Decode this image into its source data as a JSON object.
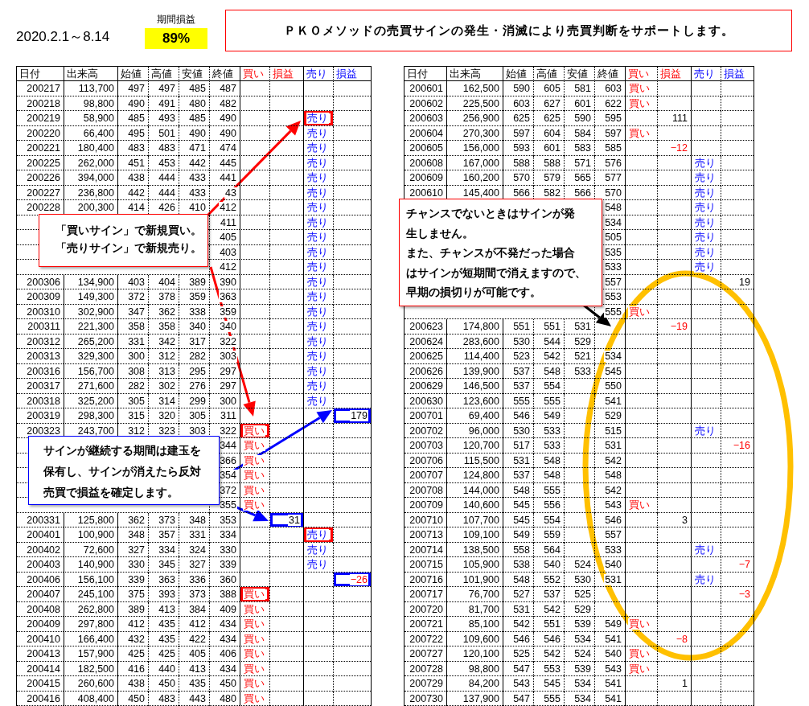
{
  "period": "2020.2.1～8.14",
  "profit": {
    "label": "期間損益",
    "value": "89%"
  },
  "banner": "ＰＫＯメソッドの売買サインの発生・消滅により売買判断をサポートします。",
  "tables": [
    {
      "columns": [
        {
          "label": "日付",
          "kind": "text"
        },
        {
          "label": "出来高",
          "kind": "text"
        },
        {
          "label": "始値",
          "kind": "text"
        },
        {
          "label": "高値",
          "kind": "text"
        },
        {
          "label": "安値",
          "kind": "text"
        },
        {
          "label": "終値",
          "kind": "text"
        },
        {
          "label": "買い",
          "kind": "buy_signal"
        },
        {
          "label": "損益",
          "kind": "buy_pl"
        },
        {
          "label": "売り",
          "kind": "sell_signal"
        },
        {
          "label": "損益",
          "kind": "sell_pl"
        }
      ],
      "rows": [
        {
          "cells": [
            "200217",
            "113,700",
            "497",
            "497",
            "485",
            "487",
            null,
            null,
            null,
            null
          ]
        },
        {
          "cells": [
            "200218",
            "98,800",
            "490",
            "491",
            "480",
            "482",
            null,
            null,
            null,
            null
          ]
        },
        {
          "cells": [
            "200219",
            "58,900",
            "485",
            "493",
            "485",
            "490",
            null,
            null,
            {
              "text": "売り",
              "color": "#ff0000"
            },
            null
          ]
        },
        {
          "cells": [
            "200220",
            "66,400",
            "495",
            "501",
            "490",
            "490",
            null,
            null,
            "売り",
            null
          ]
        },
        {
          "cells": [
            "200221",
            "180,400",
            "483",
            "483",
            "471",
            "474",
            null,
            null,
            "売り",
            null
          ]
        },
        {
          "cells": [
            "200225",
            "262,000",
            "451",
            "453",
            "442",
            "445",
            null,
            null,
            "売り",
            null
          ]
        },
        {
          "cells": [
            "200226",
            "394,000",
            "438",
            "444",
            "433",
            "441",
            null,
            null,
            "売り",
            null
          ]
        },
        {
          "cells": [
            "200227",
            "236,800",
            "442",
            "444",
            "433",
            "43",
            null,
            null,
            "売り",
            null
          ]
        },
        {
          "cells": [
            "200228",
            "200,300",
            "414",
            "426",
            "410",
            "412",
            null,
            null,
            "売り",
            null
          ]
        },
        {
          "cells": [
            null,
            null,
            null,
            null,
            null,
            "411",
            null,
            null,
            "売り",
            null
          ]
        },
        {
          "cells": [
            null,
            null,
            null,
            null,
            null,
            "405",
            null,
            null,
            "売り",
            null
          ]
        },
        {
          "cells": [
            null,
            null,
            null,
            null,
            null,
            "403",
            null,
            null,
            "売り",
            null
          ]
        },
        {
          "cells": [
            null,
            null,
            null,
            null,
            null,
            "412",
            null,
            null,
            "売り",
            null
          ]
        },
        {
          "cells": [
            "200306",
            "134,900",
            "403",
            "404",
            "389",
            "390",
            null,
            null,
            "売り",
            null
          ]
        },
        {
          "cells": [
            "200309",
            "149,300",
            "372",
            "378",
            "359",
            "363",
            null,
            null,
            "売り",
            null
          ]
        },
        {
          "cells": [
            "200310",
            "302,900",
            "347",
            "362",
            "338",
            "359",
            null,
            null,
            "売り",
            null
          ]
        },
        {
          "cells": [
            "200311",
            "221,300",
            "358",
            "358",
            "340",
            "340",
            null,
            null,
            "売り",
            null
          ]
        },
        {
          "cells": [
            "200312",
            "265,200",
            "331",
            "342",
            "317",
            "322",
            null,
            null,
            "売り",
            null
          ]
        },
        {
          "cells": [
            "200313",
            "329,300",
            "300",
            "312",
            "282",
            "303",
            null,
            null,
            "売り",
            null
          ]
        },
        {
          "cells": [
            "200316",
            "156,700",
            "308",
            "313",
            "295",
            "297",
            null,
            null,
            "売り",
            null
          ]
        },
        {
          "cells": [
            "200317",
            "271,600",
            "282",
            "302",
            "276",
            "297",
            null,
            null,
            "売り",
            null
          ]
        },
        {
          "cells": [
            "200318",
            "325,200",
            "305",
            "314",
            "299",
            "300",
            null,
            null,
            "売り",
            null
          ]
        },
        {
          "cells": [
            "200319",
            "298,300",
            "315",
            "320",
            "305",
            "311",
            null,
            null,
            null,
            {
              "text": "179",
              "color": "#0000ff"
            }
          ]
        },
        {
          "cells": [
            "200323",
            "243,700",
            "312",
            "323",
            "303",
            "322",
            {
              "text": "買い",
              "color": "#ff0000"
            },
            null,
            null,
            null
          ]
        },
        {
          "cells": [
            null,
            null,
            null,
            null,
            null,
            "344",
            "買い",
            null,
            null,
            null
          ]
        },
        {
          "cells": [
            null,
            null,
            null,
            null,
            null,
            "366",
            "買い",
            null,
            null,
            null
          ]
        },
        {
          "cells": [
            null,
            null,
            null,
            null,
            null,
            "354",
            "買い",
            null,
            null,
            null
          ]
        },
        {
          "cells": [
            null,
            null,
            null,
            null,
            null,
            "372",
            "買い",
            null,
            null,
            null
          ]
        },
        {
          "cells": [
            null,
            null,
            null,
            null,
            null,
            "355",
            "買い",
            null,
            null,
            null
          ]
        },
        {
          "cells": [
            "200331",
            "125,800",
            "362",
            "373",
            "348",
            "353",
            null,
            {
              "text": "31",
              "color": "#0000ff"
            },
            null,
            null
          ]
        },
        {
          "cells": [
            "200401",
            "100,900",
            "348",
            "357",
            "331",
            "334",
            null,
            null,
            {
              "text": "売り",
              "color": "#ff0000"
            },
            null
          ]
        },
        {
          "cells": [
            "200402",
            "72,600",
            "327",
            "334",
            "324",
            "330",
            null,
            null,
            "売り",
            null
          ]
        },
        {
          "cells": [
            "200403",
            "140,900",
            "330",
            "345",
            "327",
            "339",
            null,
            null,
            "売り",
            null
          ]
        },
        {
          "cells": [
            "200406",
            "156,100",
            "339",
            "363",
            "336",
            "360",
            null,
            null,
            null,
            {
              "text": "−26",
              "color": "#0000ff"
            }
          ],
          "loss": true
        },
        {
          "cells": [
            "200407",
            "245,100",
            "375",
            "393",
            "373",
            "388",
            {
              "text": "買い",
              "color": "#ff0000"
            },
            null,
            null,
            null
          ]
        },
        {
          "cells": [
            "200408",
            "262,800",
            "389",
            "413",
            "384",
            "409",
            "買い",
            null,
            null,
            null
          ]
        },
        {
          "cells": [
            "200409",
            "297,800",
            "412",
            "435",
            "412",
            "434",
            "買い",
            null,
            null,
            null
          ]
        },
        {
          "cells": [
            "200410",
            "166,400",
            "432",
            "435",
            "422",
            "434",
            "買い",
            null,
            null,
            null
          ]
        },
        {
          "cells": [
            "200413",
            "157,900",
            "425",
            "425",
            "405",
            "406",
            "買い",
            null,
            null,
            null
          ]
        },
        {
          "cells": [
            "200414",
            "182,500",
            "416",
            "440",
            "413",
            "434",
            "買い",
            null,
            null,
            null
          ]
        },
        {
          "cells": [
            "200415",
            "260,600",
            "438",
            "450",
            "435",
            "450",
            "買い",
            null,
            null,
            null
          ]
        },
        {
          "cells": [
            "200416",
            "408,400",
            "450",
            "483",
            "443",
            "480",
            "買い",
            null,
            null,
            null
          ]
        }
      ]
    },
    {
      "columns": [
        {
          "label": "日付",
          "kind": "text"
        },
        {
          "label": "出来高",
          "kind": "text"
        },
        {
          "label": "始値",
          "kind": "text"
        },
        {
          "label": "高値",
          "kind": "text"
        },
        {
          "label": "安値",
          "kind": "text"
        },
        {
          "label": "終値",
          "kind": "text"
        },
        {
          "label": "買い",
          "kind": "buy_signal"
        },
        {
          "label": "損益",
          "kind": "buy_pl"
        },
        {
          "label": "売り",
          "kind": "sell_signal"
        },
        {
          "label": "損益",
          "kind": "sell_pl"
        }
      ],
      "rows": [
        {
          "cells": [
            "200601",
            "162,500",
            "590",
            "605",
            "581",
            "603",
            "買い",
            null,
            null,
            null
          ]
        },
        {
          "cells": [
            "200602",
            "225,500",
            "603",
            "627",
            "601",
            "622",
            "買い",
            null,
            null,
            null
          ]
        },
        {
          "cells": [
            "200603",
            "256,900",
            "625",
            "625",
            "590",
            "595",
            null,
            "111",
            null,
            null
          ]
        },
        {
          "cells": [
            "200604",
            "270,300",
            "597",
            "604",
            "584",
            "597",
            "買い",
            null,
            null,
            null
          ]
        },
        {
          "cells": [
            "200605",
            "156,000",
            "593",
            "601",
            "583",
            "585",
            null,
            "−12",
            null,
            null
          ],
          "loss": true
        },
        {
          "cells": [
            "200608",
            "167,000",
            "588",
            "588",
            "571",
            "576",
            null,
            null,
            "売り",
            null
          ]
        },
        {
          "cells": [
            "200609",
            "160,200",
            "570",
            "579",
            "565",
            "577",
            null,
            null,
            "売り",
            null
          ]
        },
        {
          "cells": [
            "200610",
            "145,400",
            "566",
            "582",
            "566",
            "570",
            null,
            null,
            "売り",
            null
          ]
        },
        {
          "cells": [
            null,
            null,
            null,
            null,
            null,
            "548",
            null,
            null,
            "売り",
            null
          ]
        },
        {
          "cells": [
            null,
            null,
            null,
            null,
            null,
            "534",
            null,
            null,
            "売り",
            null
          ]
        },
        {
          "cells": [
            null,
            null,
            null,
            null,
            null,
            "505",
            null,
            null,
            "売り",
            null
          ]
        },
        {
          "cells": [
            null,
            null,
            null,
            null,
            null,
            "535",
            null,
            null,
            "売り",
            null
          ]
        },
        {
          "cells": [
            null,
            null,
            null,
            null,
            null,
            "533",
            null,
            null,
            "売り",
            null
          ]
        },
        {
          "cells": [
            null,
            null,
            null,
            null,
            null,
            "557",
            null,
            null,
            null,
            "19"
          ]
        },
        {
          "cells": [
            null,
            null,
            null,
            null,
            null,
            "553",
            null,
            null,
            null,
            null
          ]
        },
        {
          "cells": [
            null,
            null,
            null,
            null,
            null,
            "555",
            "買い",
            null,
            null,
            null
          ]
        },
        {
          "cells": [
            "200623",
            "174,800",
            "551",
            "551",
            "531",
            null,
            null,
            "−19",
            null,
            null
          ],
          "loss": true
        },
        {
          "cells": [
            "200624",
            "283,600",
            "530",
            "544",
            "529",
            null,
            null,
            null,
            null,
            null
          ]
        },
        {
          "cells": [
            "200625",
            "114,400",
            "523",
            "542",
            "521",
            "534",
            null,
            null,
            null,
            null
          ]
        },
        {
          "cells": [
            "200626",
            "139,900",
            "537",
            "548",
            "533",
            "545",
            null,
            null,
            null,
            null
          ]
        },
        {
          "cells": [
            "200629",
            "146,500",
            "537",
            "554",
            null,
            "550",
            null,
            null,
            null,
            null
          ]
        },
        {
          "cells": [
            "200630",
            "123,600",
            "555",
            "555",
            null,
            "541",
            null,
            null,
            null,
            null
          ]
        },
        {
          "cells": [
            "200701",
            "69,400",
            "546",
            "549",
            null,
            "529",
            null,
            null,
            null,
            null
          ]
        },
        {
          "cells": [
            "200702",
            "96,000",
            "530",
            "533",
            null,
            "515",
            null,
            null,
            "売り",
            null
          ]
        },
        {
          "cells": [
            "200703",
            "120,700",
            "517",
            "533",
            null,
            "531",
            null,
            null,
            null,
            "−16"
          ],
          "loss": true
        },
        {
          "cells": [
            "200706",
            "115,500",
            "531",
            "548",
            null,
            "542",
            null,
            null,
            null,
            null
          ]
        },
        {
          "cells": [
            "200707",
            "124,800",
            "537",
            "548",
            null,
            "548",
            null,
            null,
            null,
            null
          ]
        },
        {
          "cells": [
            "200708",
            "144,000",
            "548",
            "555",
            null,
            "542",
            null,
            null,
            null,
            null
          ]
        },
        {
          "cells": [
            "200709",
            "140,600",
            "545",
            "556",
            null,
            "543",
            "買い",
            null,
            null,
            null
          ]
        },
        {
          "cells": [
            "200710",
            "107,700",
            "545",
            "554",
            null,
            "546",
            null,
            "3",
            null,
            null
          ]
        },
        {
          "cells": [
            "200713",
            "109,100",
            "549",
            "559",
            null,
            "557",
            null,
            null,
            null,
            null
          ]
        },
        {
          "cells": [
            "200714",
            "138,500",
            "558",
            "564",
            null,
            "533",
            null,
            null,
            "売り",
            null
          ]
        },
        {
          "cells": [
            "200715",
            "105,900",
            "538",
            "540",
            "524",
            "540",
            null,
            null,
            null,
            "−7"
          ],
          "loss": true
        },
        {
          "cells": [
            "200716",
            "101,900",
            "548",
            "552",
            "530",
            "531",
            null,
            null,
            "売り",
            null
          ]
        },
        {
          "cells": [
            "200717",
            "76,700",
            "527",
            "537",
            "525",
            null,
            null,
            null,
            null,
            "−3"
          ],
          "loss": true
        },
        {
          "cells": [
            "200720",
            "81,700",
            "531",
            "542",
            "529",
            null,
            null,
            null,
            null,
            null
          ]
        },
        {
          "cells": [
            "200721",
            "85,100",
            "542",
            "551",
            "539",
            "549",
            "買い",
            null,
            null,
            null
          ]
        },
        {
          "cells": [
            "200722",
            "109,600",
            "546",
            "546",
            "534",
            "541",
            null,
            "−8",
            null,
            null
          ],
          "loss": true
        },
        {
          "cells": [
            "200727",
            "120,100",
            "525",
            "542",
            "524",
            "540",
            "買い",
            null,
            null,
            null
          ]
        },
        {
          "cells": [
            "200728",
            "98,800",
            "547",
            "553",
            "539",
            "543",
            "買い",
            null,
            null,
            null
          ]
        },
        {
          "cells": [
            "200729",
            "84,200",
            "543",
            "545",
            "534",
            "541",
            null,
            "1",
            null,
            null
          ]
        },
        {
          "cells": [
            "200730",
            "137,900",
            "547",
            "555",
            "534",
            "541",
            null,
            null,
            null,
            null
          ]
        }
      ]
    }
  ],
  "callouts": [
    {
      "color": "#ff0000",
      "lines": [
        "「買いサイン」で新規買い。",
        "「売りサイン」で新規売り。"
      ]
    },
    {
      "color": "#0000ff",
      "lines": [
        "サインが継続する期間は建玉を",
        "保有し、サインが消えたら反対",
        "売買で損益を確定します。"
      ]
    },
    {
      "color": "#ff0000",
      "lines": [
        "チャンスでないときはサインが発",
        "生しません。",
        "また、チャンスが不発だった場合",
        "はサインが短期間で消えますので、",
        "早期の損切りが可能です。"
      ]
    }
  ]
}
